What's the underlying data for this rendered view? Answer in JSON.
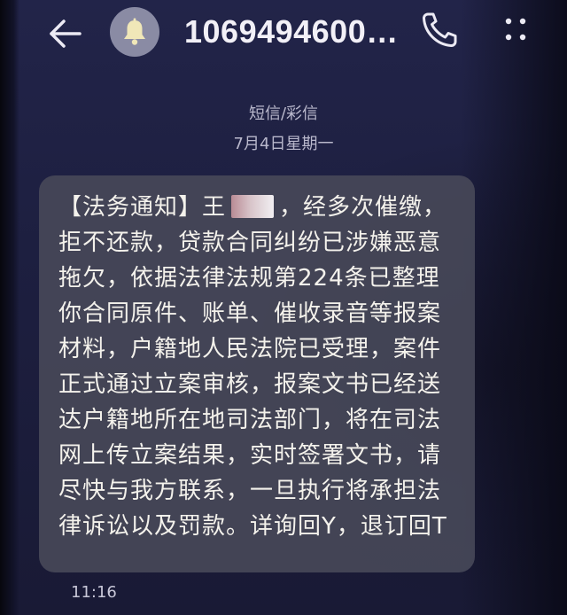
{
  "header": {
    "back_icon": "arrow-left-icon",
    "bell_icon": "bell-icon",
    "contact": "1069494600…",
    "call_icon": "phone-icon",
    "more_icon": "more-dots-icon"
  },
  "thread": {
    "message_type": "短信/彩信",
    "date": "7月4日星期一"
  },
  "message": {
    "prefix": "【法务通知】王",
    "body": "，经多次催缴，拒不还款，贷款合同纠纷已涉嫌恶意拖欠，依据法律法规第224条已整理你合同原件、账单、催收录音等报案材料，户籍地人民法院已受理，案件正式通过立案审核，报案文书已经送达户籍地所在地司法部门，将在司法网上传立案结果，实时签署文书，请尽快与我方联系，一旦执行将承担法律诉讼以及罚款。详询回Y，退订回T",
    "time": "11:16"
  },
  "colors": {
    "background": "#1c1d3a",
    "bubble": "#464858",
    "bell_circle": "#8a8ba4",
    "text": "#f4f2ec"
  }
}
